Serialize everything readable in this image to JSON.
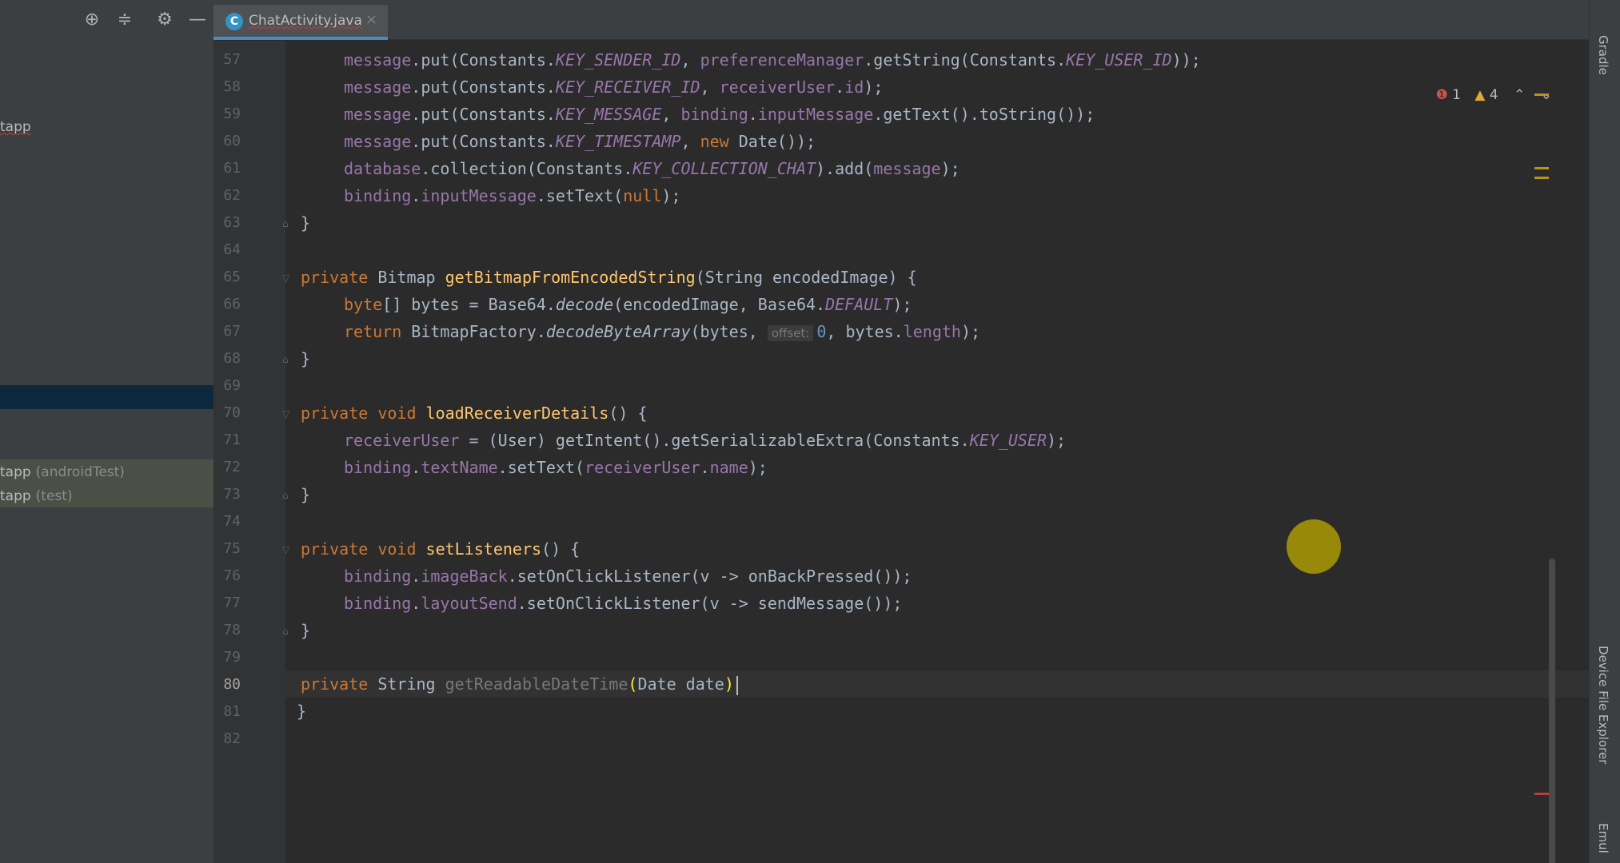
{
  "tab": {
    "label": "ChatActivity.java",
    "file_icon": "C",
    "close_glyph": "×"
  },
  "inspections": {
    "errors": "1",
    "warnings": "4"
  },
  "project_tree": [
    {
      "label": "tapp",
      "suffix": ""
    },
    {
      "label": "tapp",
      "suffix": "(androidTest)"
    },
    {
      "label": "tapp",
      "suffix": "(test)"
    }
  ],
  "line_numbers": [
    "57",
    "58",
    "59",
    "60",
    "61",
    "62",
    "63",
    "64",
    "65",
    "66",
    "67",
    "68",
    "69",
    "70",
    "71",
    "72",
    "73",
    "74",
    "75",
    "76",
    "77",
    "78",
    "79",
    "80",
    "81",
    "82"
  ],
  "code": {
    "l57": [
      "message",
      ".put(Constants.",
      "KEY_SENDER_ID",
      ", ",
      "preferenceManager",
      ".getString(Constants.",
      "KEY_USER_ID",
      "));"
    ],
    "l58": [
      "message",
      ".put(Constants.",
      "KEY_RECEIVER_ID",
      ", ",
      "receiverUser",
      ".",
      "id",
      ");"
    ],
    "l59": [
      "message",
      ".put(Constants.",
      "KEY_MESSAGE",
      ", ",
      "binding",
      ".",
      "inputMessage",
      ".getText().toString());"
    ],
    "l60": [
      "message",
      ".put(Constants.",
      "KEY_TIMESTAMP",
      ", ",
      "new ",
      "Date());"
    ],
    "l61": [
      "database",
      ".collection(Constants.",
      "KEY_COLLECTION_CHAT",
      ").add(",
      "message",
      ");"
    ],
    "l62": [
      "binding",
      ".",
      "inputMessage",
      ".setText(",
      "null",
      ");"
    ],
    "l63": [
      "}"
    ],
    "l65": [
      "private ",
      "Bitmap ",
      "getBitmapFromEncodedString",
      "(String encodedImage) {"
    ],
    "l66": [
      "byte",
      "[] bytes = Base64.",
      "decode",
      "(encodedImage, Base64.",
      "DEFAULT",
      ");"
    ],
    "l67": [
      "return ",
      "BitmapFactory.",
      "decodeByteArray",
      "(bytes, ",
      "offset:",
      "0",
      ", bytes.",
      "length",
      ");"
    ],
    "l68": [
      "}"
    ],
    "l70": [
      "private void ",
      "loadReceiverDetails",
      "() {"
    ],
    "l71": [
      "receiverUser",
      " = (User) getIntent().getSerializableExtra(Constants.",
      "KEY_USER",
      ");"
    ],
    "l72": [
      "binding",
      ".",
      "textName",
      ".setText(",
      "receiverUser",
      ".",
      "name",
      ");"
    ],
    "l73": [
      "}"
    ],
    "l75": [
      "private void ",
      "setListeners",
      "() {"
    ],
    "l76": [
      "binding",
      ".",
      "imageBack",
      ".setOnClickListener(v -> onBackPressed());"
    ],
    "l77": [
      "binding",
      ".",
      "layoutSend",
      ".setOnClickListener(v -> sendMessage());"
    ],
    "l78": [
      "}"
    ],
    "l80": [
      "private ",
      "String ",
      "getReadableDateTime",
      "(",
      "Date date",
      ")"
    ],
    "l81": [
      "}"
    ]
  },
  "right_tools": {
    "top": "Gradle",
    "middle": "Device File Explorer",
    "bottom": "Emul"
  },
  "colors": {
    "keyword": "#cc7832",
    "field": "#9876aa",
    "method": "#ffc66d",
    "number": "#6897bb",
    "background": "#2b2b2b"
  }
}
